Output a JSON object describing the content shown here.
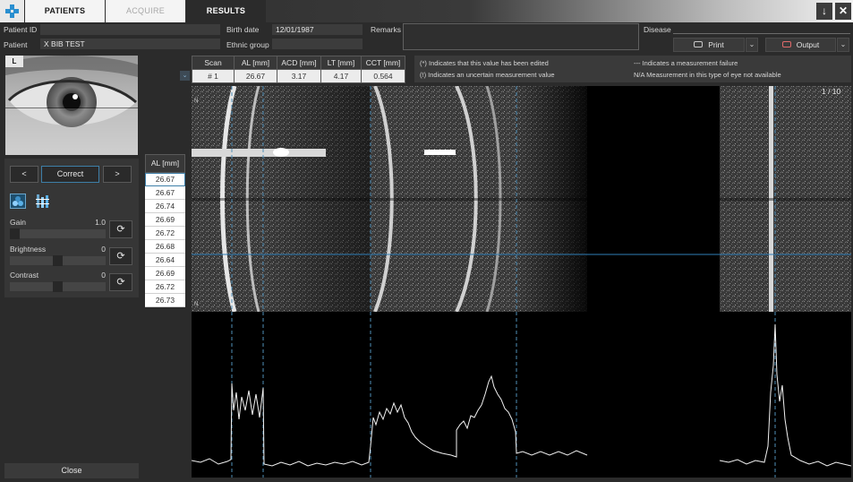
{
  "tabs": {
    "patients": "PATIENTS",
    "acquire": "ACQUIRE",
    "results": "RESULTS"
  },
  "window": {
    "download_icon": "download-arrow-icon",
    "close_icon": "close-x-icon"
  },
  "patient": {
    "id_label": "Patient ID",
    "id_value": "",
    "name_label": "Patient",
    "name_value": "X BIB TEST",
    "birth_label": "Birth date",
    "birth_value": "12/01/1987",
    "ethnic_label": "Ethnic group",
    "ethnic_value": "",
    "remarks_label": "Remarks",
    "disease_label": "Disease"
  },
  "actions": {
    "print": "Print",
    "output": "Output"
  },
  "eye": {
    "side": "L"
  },
  "nav": {
    "prev": "<",
    "correct": "Correct",
    "next": ">"
  },
  "adjust": {
    "gain_label": "Gain",
    "gain_value": "1.0",
    "gain_level": 0.0,
    "brightness_label": "Brightness",
    "brightness_value": "0",
    "brightness_level": 0.5,
    "contrast_label": "Contrast",
    "contrast_value": "0",
    "contrast_level": 0.5
  },
  "close_label": "Close",
  "al_list": {
    "header": "AL [mm]",
    "values": [
      "26.67",
      "26.67",
      "26.74",
      "26.69",
      "26.72",
      "26.68",
      "26.64",
      "26.69",
      "26.72",
      "26.73"
    ],
    "selected_index": 0
  },
  "measurements": {
    "headers": [
      "Scan",
      "AL [mm]",
      "ACD [mm]",
      "LT [mm]",
      "CCT [mm]"
    ],
    "row": [
      "# 1",
      "26.67",
      "3.17",
      "4.17",
      "0.564"
    ]
  },
  "legend": {
    "edited": "(*)  Indicates that this value has been edited",
    "uncertain": "(!)  Indicates an uncertain measurement value",
    "failure": "---  Indicates a measurement failure",
    "na": "N/A  Measurement in this type of eye not available"
  },
  "scan": {
    "counter": "1 / 10",
    "axis_top": "N",
    "axis_bottom": "N"
  },
  "colors": {
    "accent": "#3e7fa8",
    "guide": "#4f8fb8",
    "background": "#2b2b2b"
  }
}
